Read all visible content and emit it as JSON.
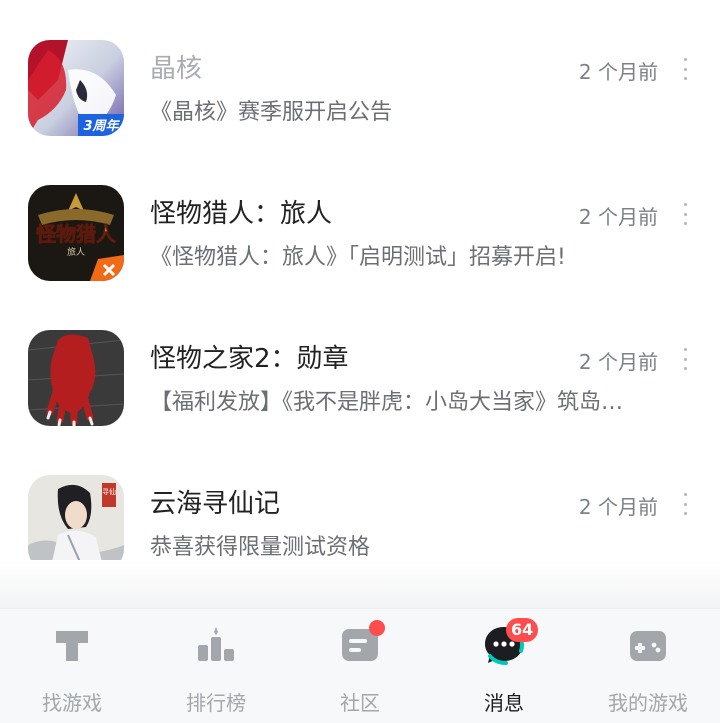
{
  "messages": [
    {
      "title": "晶核",
      "subtitle": "《晶核》赛季服开启公告",
      "time": "2 个月前",
      "icon": "jinghe-game-icon",
      "faded": true
    },
    {
      "title": "怪物猎人：旅人",
      "subtitle": "《怪物猎人：旅人》「启明测试」招募开启!",
      "time": "2 个月前",
      "icon": "monster-hunter-game-icon",
      "faded": false
    },
    {
      "title": "怪物之家2：勋章",
      "subtitle": "【福利发放】《我不是胖虎：小岛大当家》筑岛…",
      "time": "2 个月前",
      "icon": "monster-house-game-icon",
      "faded": false
    },
    {
      "title": "云海寻仙记",
      "subtitle": "恭喜获得限量测试资格",
      "time": "2 个月前",
      "icon": "yunhai-game-icon",
      "faded": false
    }
  ],
  "icon_text": {
    "jinghe_badge": "3周年",
    "mh_logo": "怪物猎人",
    "mh_sub": "旅人",
    "yunhai_seal": "寻仙"
  },
  "tabs": [
    {
      "label": "找游戏",
      "icon": "find-game-icon",
      "active": false
    },
    {
      "label": "排行榜",
      "icon": "ranking-icon",
      "active": false
    },
    {
      "label": "社区",
      "icon": "community-icon",
      "active": false
    },
    {
      "label": "消息",
      "icon": "message-icon",
      "active": true
    },
    {
      "label": "我的游戏",
      "icon": "my-games-icon",
      "active": false
    }
  ],
  "message_badge": "64",
  "colors": {
    "accent": "#00c9b8",
    "badge": "#ff4d4f",
    "tab_inactive": "#a3a7ac"
  }
}
